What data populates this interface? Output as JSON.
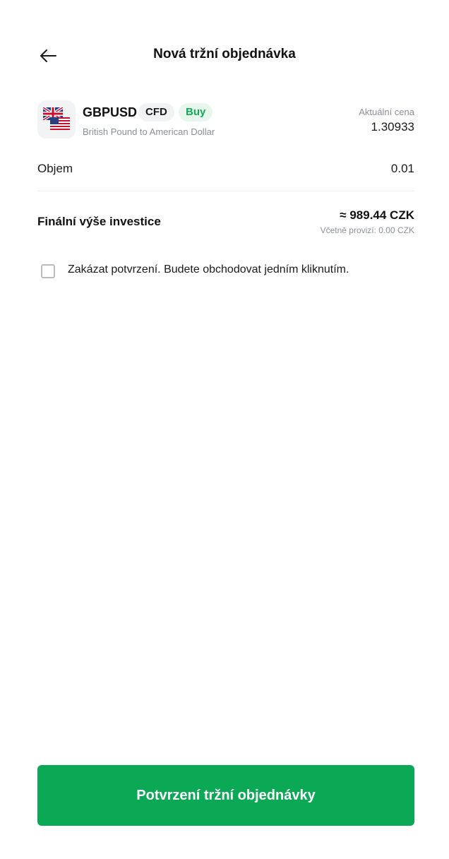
{
  "header": {
    "title": "Nová tržní objednávka",
    "back_icon": "arrow-left-icon"
  },
  "instrument": {
    "symbol": "GBPUSD",
    "type_badge": "CFD",
    "side_badge": "Buy",
    "name": "British Pound to American Dollar",
    "price_label": "Aktuální cena",
    "price_value": "1.30933",
    "flag_icons": [
      "uk-flag-icon",
      "us-flag-icon"
    ]
  },
  "volume": {
    "label": "Objem",
    "value": "0.01"
  },
  "investment": {
    "label": "Finální výše investice",
    "value": "≈ 989.44 CZK",
    "fee_note": "Včetně provizí: 0.00 CZK"
  },
  "confirmation": {
    "checked": false,
    "label": "Zakázat potvrzení. Budete obchodovat jedním kliknutím."
  },
  "submit": {
    "label": "Potvrzení tržní objednávky"
  },
  "colors": {
    "accent": "#0ba955",
    "buy_text": "#0fa958",
    "buy_bg": "#e8f6ee",
    "muted_text": "#8a8f96"
  }
}
